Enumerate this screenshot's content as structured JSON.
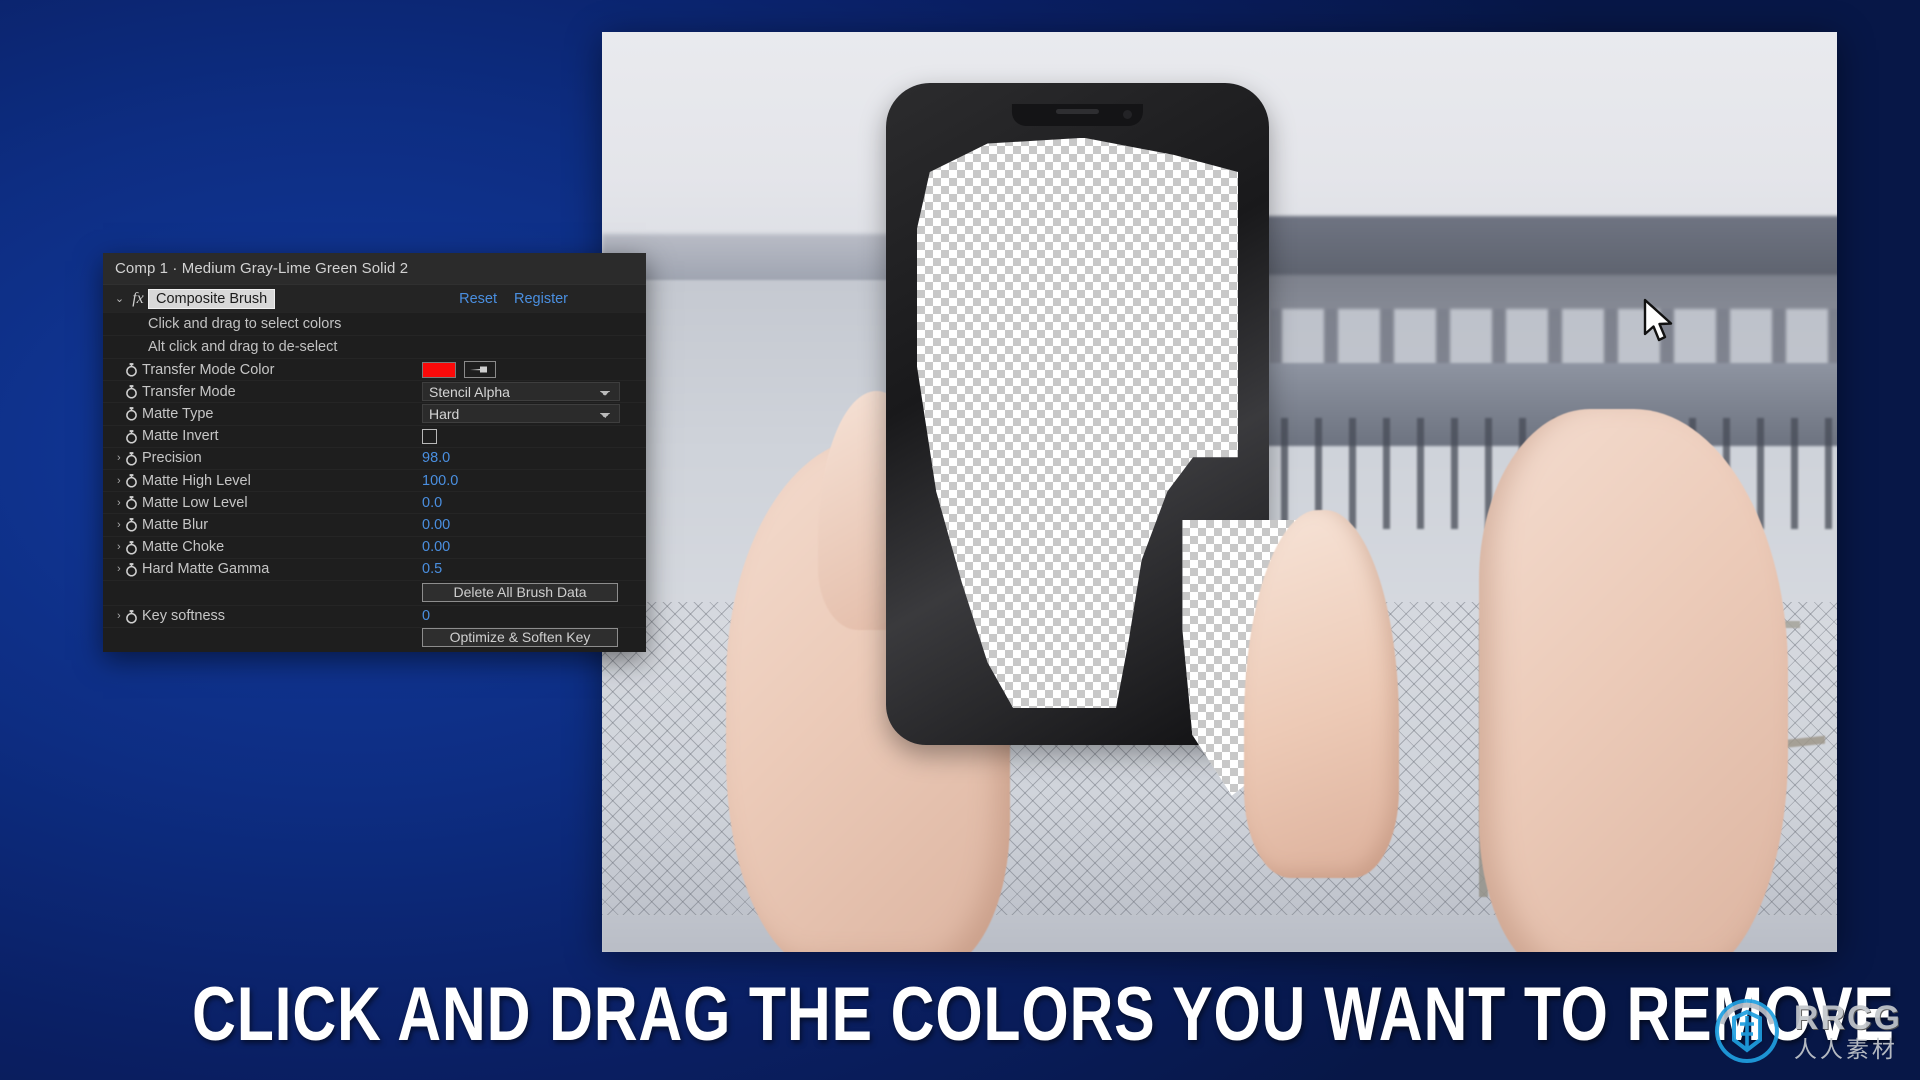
{
  "panel": {
    "title": "Comp 1 · Medium Gray-Lime Green Solid 2",
    "effect": {
      "name": "Composite Brush",
      "fx_glyph": "fx",
      "twirl": "⌄",
      "reset_label": "Reset",
      "register_label": "Register"
    },
    "hints": [
      "Click and drag to select colors",
      "Alt click and drag to de-select"
    ],
    "properties": [
      {
        "label": "Transfer Mode Color",
        "type": "color",
        "value": "#fb0a0a",
        "expandable": false,
        "stopwatch": "stopwatch-icon",
        "eyedropper": "eyedropper-icon"
      },
      {
        "label": "Transfer Mode",
        "type": "dropdown",
        "value": "Stencil Alpha",
        "expandable": false,
        "stopwatch": "stopwatch-icon"
      },
      {
        "label": "Matte Type",
        "type": "dropdown",
        "value": "Hard",
        "expandable": false,
        "stopwatch": "stopwatch-icon"
      },
      {
        "label": "Matte Invert",
        "type": "checkbox",
        "value": "",
        "checked": false,
        "expandable": false,
        "stopwatch": "stopwatch-icon"
      },
      {
        "label": "Precision",
        "type": "number",
        "value": "98.0",
        "expandable": true,
        "stopwatch": "stopwatch-icon"
      },
      {
        "label": "Matte High Level",
        "type": "number",
        "value": "100.0",
        "expandable": true,
        "stopwatch": "stopwatch-icon"
      },
      {
        "label": "Matte Low Level",
        "type": "number",
        "value": "0.0",
        "expandable": true,
        "stopwatch": "stopwatch-icon"
      },
      {
        "label": "Matte Blur",
        "type": "number",
        "value": "0.00",
        "expandable": true,
        "stopwatch": "stopwatch-icon"
      },
      {
        "label": "Matte Choke",
        "type": "number",
        "value": "0.00",
        "expandable": true,
        "stopwatch": "stopwatch-icon"
      },
      {
        "label": "Hard Matte Gamma",
        "type": "number",
        "value": "0.5",
        "expandable": true,
        "stopwatch": "stopwatch-icon"
      }
    ],
    "buttons": {
      "delete_all_brush_data": "Delete All Brush Data",
      "optimize_soften_key": "Optimize & Soften Key"
    },
    "key_softness": {
      "label": "Key softness",
      "value": "0",
      "expandable": true,
      "stopwatch": "stopwatch-icon"
    },
    "colors": {
      "link": "#4a8fe0",
      "value": "#4a8fe0",
      "panel_bg": "#1e1e1e",
      "title_bg": "#2b2b2b",
      "transfer_mode_color": "#fb0a0a"
    }
  },
  "viewer": {
    "cursor": "arrow-cursor",
    "transparency": "checkerboard-transparency"
  },
  "caption": {
    "text": "CLICK AND DRAG THE COLORS YOU WANT TO REMOVE"
  },
  "watermark": {
    "brand": "RRCG",
    "chinese": "人人素材",
    "logo_color": "#1f9fe0"
  },
  "background": {
    "color": "#0a2472"
  }
}
